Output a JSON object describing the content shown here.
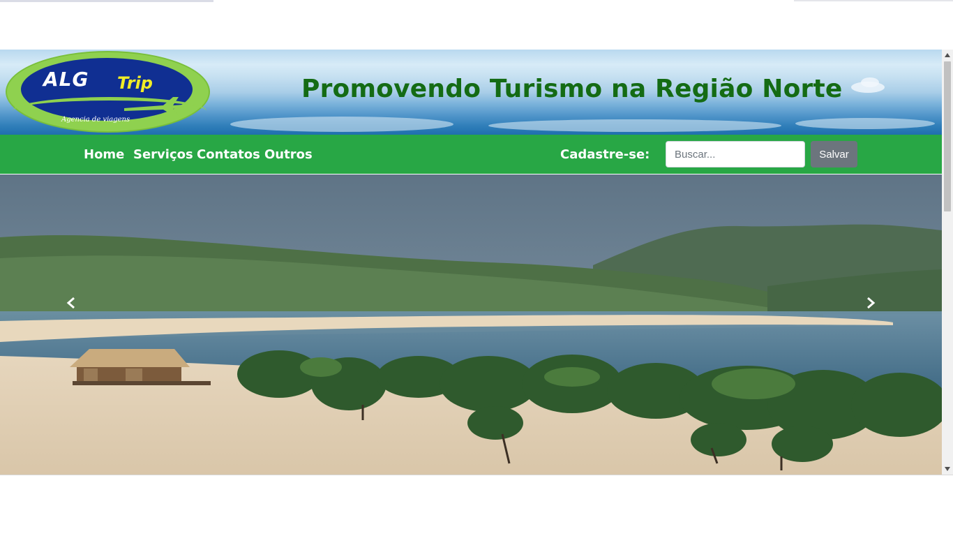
{
  "logo": {
    "brand": "ALG",
    "brand_accent": "Trip",
    "tagline": "Agencia de viagens"
  },
  "header": {
    "title": "Promovendo Turismo na Região Norte"
  },
  "nav": {
    "items": [
      {
        "label": "Home"
      },
      {
        "label": "Serviços"
      },
      {
        "label": "Contatos"
      },
      {
        "label": "Outros"
      }
    ],
    "signup_label": "Cadastre-se:",
    "search_placeholder": "Buscar...",
    "save_label": "Salvar"
  },
  "carousel": {
    "prev_icon": "chevron-left-icon",
    "next_icon": "chevron-right-icon"
  },
  "colors": {
    "nav_green": "#28a745",
    "title_green": "#146b14",
    "button_gray": "#6c757d",
    "logo_blue": "#102f92",
    "logo_green": "#8fd14f",
    "logo_yellow": "#f0ec26"
  }
}
